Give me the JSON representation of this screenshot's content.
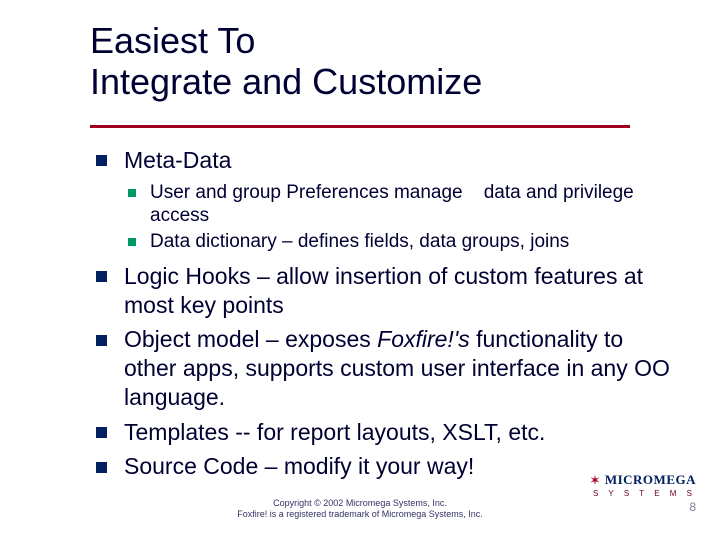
{
  "title_line1": "Easiest To",
  "title_line2": "Integrate and Customize",
  "bullets": {
    "b1": "Meta-Data",
    "b1_sub1": "User and group Preferences manage    data and privilege access",
    "b1_sub2": "Data dictionary – defines fields, data groups, joins",
    "b2": "Logic Hooks – allow insertion of custom features at most key points",
    "b3_pre": "Object model – exposes ",
    "b3_em": "Foxfire!'s",
    "b3_post": " functionality to other apps, supports custom user interface in any OO language.",
    "b4": "Templates -- for report layouts, XSLT, etc.",
    "b5": "Source Code – modify it your way!"
  },
  "footer": {
    "copyright": "Copyright © 2002 Micromega Systems, Inc.",
    "trademark": "Foxfire! is a registered trademark of Micromega Systems, Inc."
  },
  "logo": {
    "top": "MICROMEGA",
    "bottom": "S Y S T E M S"
  },
  "page_number": "8"
}
